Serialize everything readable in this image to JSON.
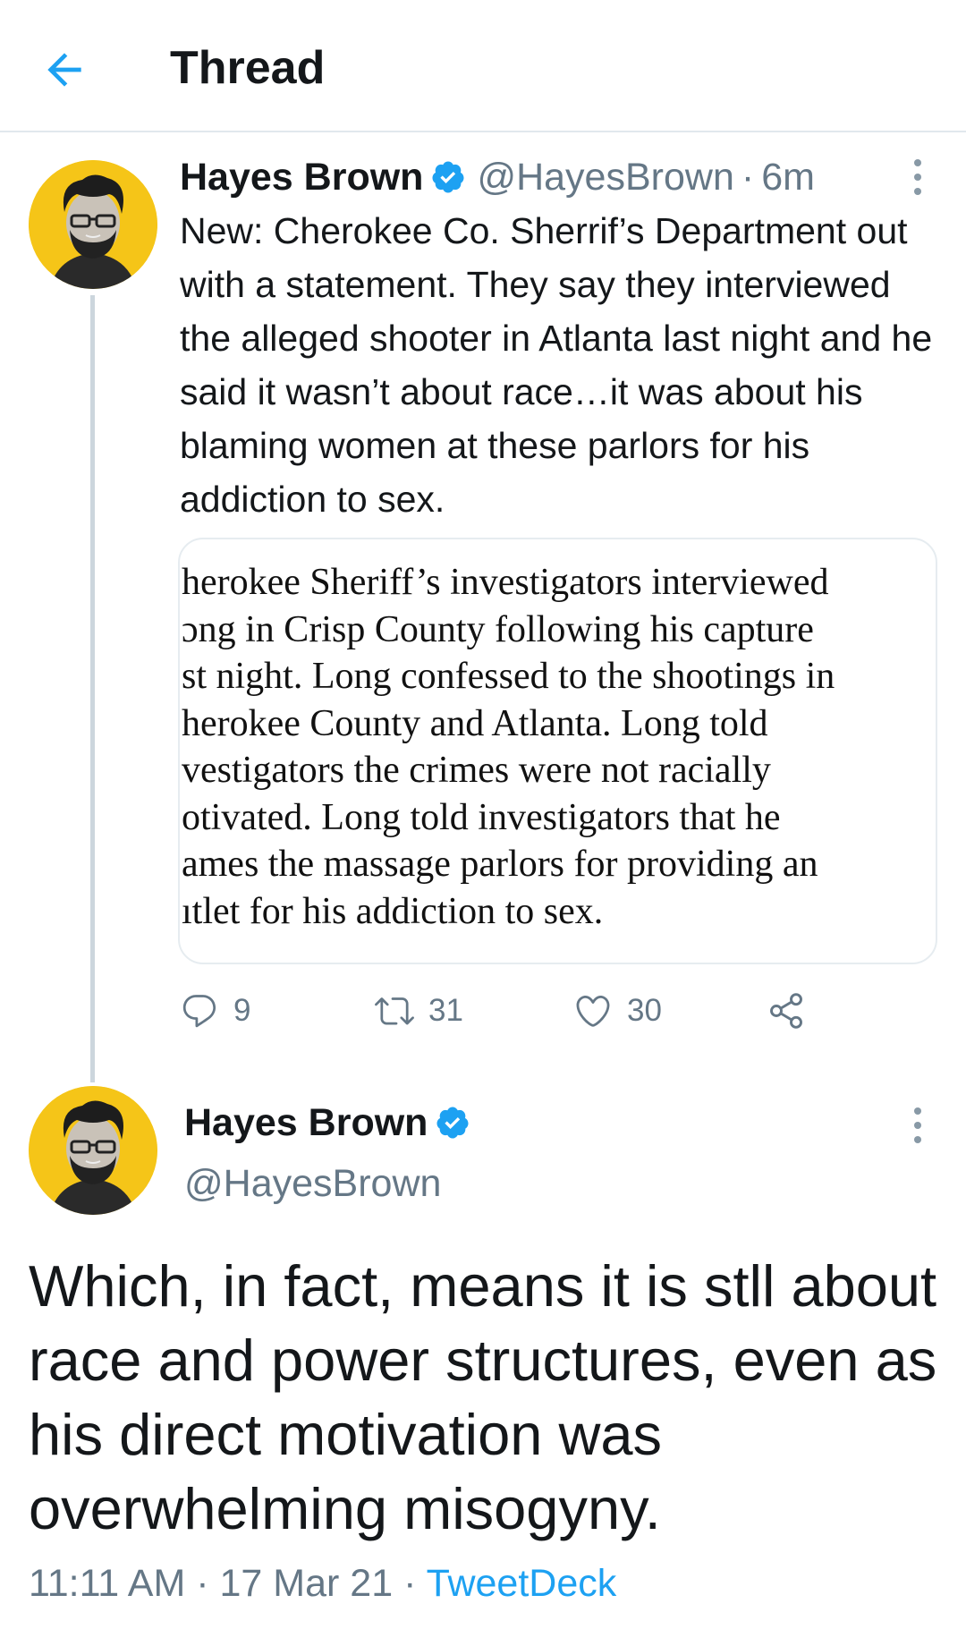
{
  "header": {
    "title": "Thread",
    "back_icon": "arrow-left-icon",
    "accent_color": "#1da1f2"
  },
  "tweets": [
    {
      "name": "Hayes Brown",
      "handle": "@HayesBrown",
      "separator": "·",
      "time": "6m",
      "verified": true,
      "text": "New: Cherokee Co. Sherrif’s Department out with a statement. They say they interviewed the alleged shooter in Atlanta last night and he said it wasn’t about race…it was about his blaming women at these parlors for his addiction to sex.",
      "media_text": "herokee Sheriff’s investigators interviewed\nɔng in Crisp County following his capture\nst night. Long confessed to the shootings in\nherokee County and Atlanta. Long told\nvestigators the crimes were not racially\notivated. Long told investigators that he\names the massage parlors for providing an\nıtlet for his addiction to sex.",
      "actions": {
        "replies": "9",
        "retweets": "31",
        "likes": "30"
      }
    },
    {
      "name": "Hayes Brown",
      "handle": "@HayesBrown",
      "verified": true,
      "text": "Which, in fact, means it is stll about race and power structures, even as his direct motivation was overwhelming misogyny.",
      "meta": {
        "time": "11:11 AM",
        "sep1": " · ",
        "date": "17 Mar 21",
        "sep2": " · ",
        "source": "TweetDeck"
      }
    }
  ],
  "colors": {
    "text": "#14171a",
    "secondary": "#657786",
    "link": "#1da1f2",
    "avatar_bg": "#f5c518"
  }
}
